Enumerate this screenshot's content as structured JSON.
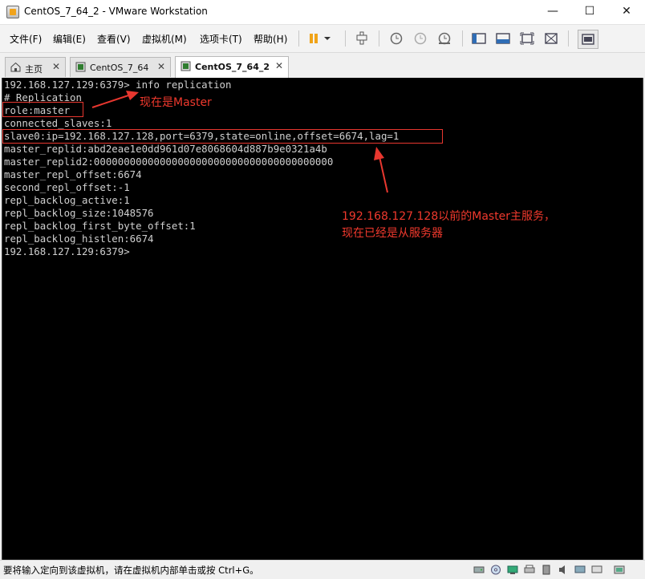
{
  "window": {
    "title": "CentOS_7_64_2 - VMware Workstation",
    "controls": [
      "—",
      "☐",
      "✕"
    ]
  },
  "menu": [
    {
      "label": "文件(F)"
    },
    {
      "label": "编辑(E)"
    },
    {
      "label": "查看(V)"
    },
    {
      "label": "虚拟机(M)"
    },
    {
      "label": "选项卡(T)"
    },
    {
      "label": "帮助(H)"
    }
  ],
  "tabs": [
    {
      "label": "主页",
      "icon": "home-icon",
      "active": false
    },
    {
      "label": "CentOS_7_64",
      "icon": "vm-icon",
      "active": false
    },
    {
      "label": "CentOS_7_64_2",
      "icon": "vm-icon",
      "active": true
    }
  ],
  "console": {
    "lines": [
      "192.168.127.129:6379> info replication",
      "# Replication",
      "role:master",
      "connected_slaves:1",
      "slave0:ip=192.168.127.128,port=6379,state=online,offset=6674,lag=1",
      "master_replid:abd2eae1e0dd961d07e8068604d887b9e0321a4b",
      "master_replid2:0000000000000000000000000000000000000000",
      "master_repl_offset:6674",
      "second_repl_offset:-1",
      "repl_backlog_active:1",
      "repl_backlog_size:1048576",
      "repl_backlog_first_byte_offset:1",
      "repl_backlog_histlen:6674",
      "192.168.127.129:6379>"
    ]
  },
  "annotations": {
    "role_note": "现在是Master",
    "slave_note_line1": "192.168.127.128以前的Master主服务，",
    "slave_note_line2": "现在已经是从服务器",
    "color": "#f0392d"
  },
  "statusbar": {
    "message": "要将输入定向到该虚拟机，请在虚拟机内部单击或按 Ctrl+G。"
  }
}
